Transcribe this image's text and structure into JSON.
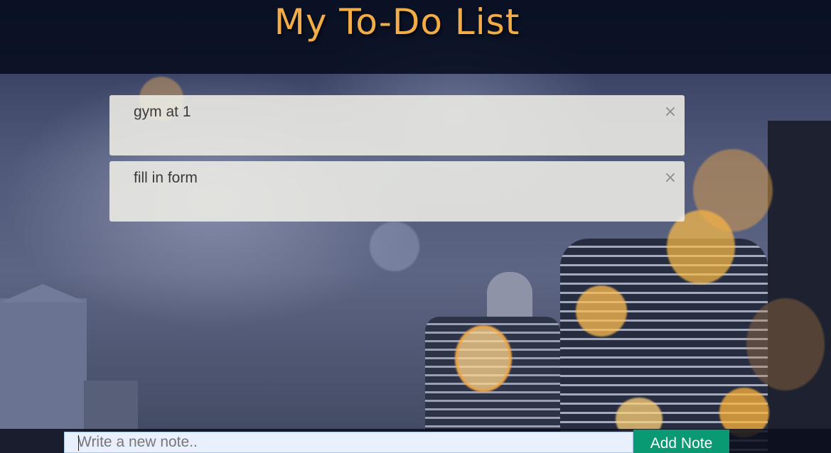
{
  "header": {
    "title": "My To-Do List"
  },
  "notes": [
    {
      "text": "gym at 1",
      "close_symbol": "×"
    },
    {
      "text": "fill in form",
      "close_symbol": "×"
    }
  ],
  "composer": {
    "input_placeholder": "Write a new note..",
    "input_value": "",
    "add_button_label": "Add Note"
  },
  "colors": {
    "title": "#f3ad47",
    "add_button": "#0a9a73",
    "note_background": "#eeeee6"
  }
}
